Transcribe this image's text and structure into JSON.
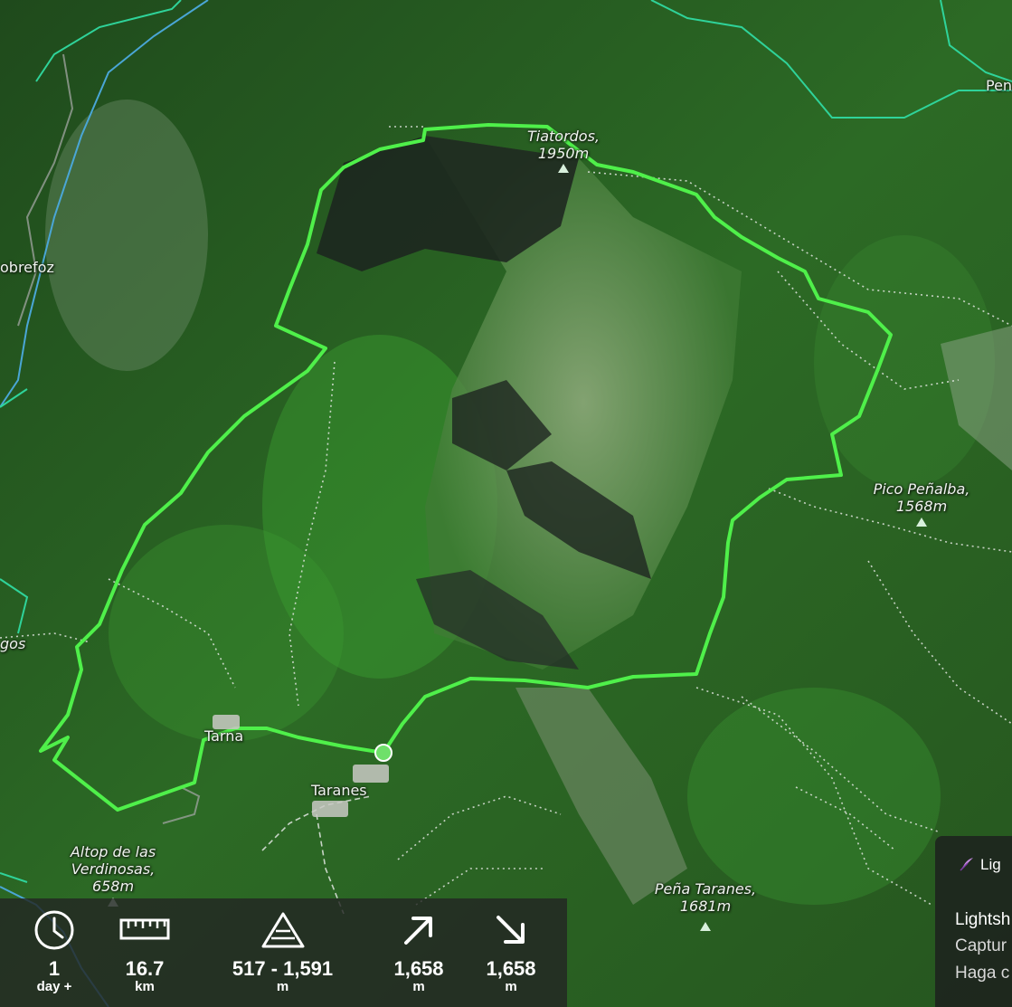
{
  "places": {
    "tiatordos_name": "Tiatordos,",
    "tiatordos_elev": "1950m",
    "pico_penalba_name": "Pico Peñalba,",
    "pico_penalba_elev": "1568m",
    "sobrefoz": "obrefoz",
    "pen_edge": "Pen",
    "gos": "gos",
    "tarna": "Tarna",
    "taranes": "Taranes",
    "altop_line1": "Altop de las",
    "altop_line2": "Verdinosas,",
    "altop_elev": "658m",
    "pena_taranes_name": "Peña Taranes,",
    "pena_taranes_elev": "1681m"
  },
  "stats": {
    "duration": {
      "icon": "clock-icon",
      "value": "1",
      "unit": "day +"
    },
    "distance": {
      "icon": "ruler-icon",
      "value": "16.7",
      "unit": "km"
    },
    "elevation_range": {
      "icon": "mountain-icon",
      "value": "517 - 1,591",
      "unit": "m"
    },
    "ascent": {
      "icon": "arrow-up-right-icon",
      "value": "1,658",
      "unit": "m"
    },
    "descent": {
      "icon": "arrow-down-right-icon",
      "value": "1,658",
      "unit": "m"
    }
  },
  "side_card": {
    "title": "Lig",
    "line1": "Lightsh",
    "line2": "Captur",
    "line3": "Haga c"
  },
  "colors": {
    "route": "#4ff04a",
    "start_marker": "#6fe06a",
    "river": "#4aa6d6",
    "boundary": "#2fd39a",
    "trail": "#e2e6e0"
  }
}
